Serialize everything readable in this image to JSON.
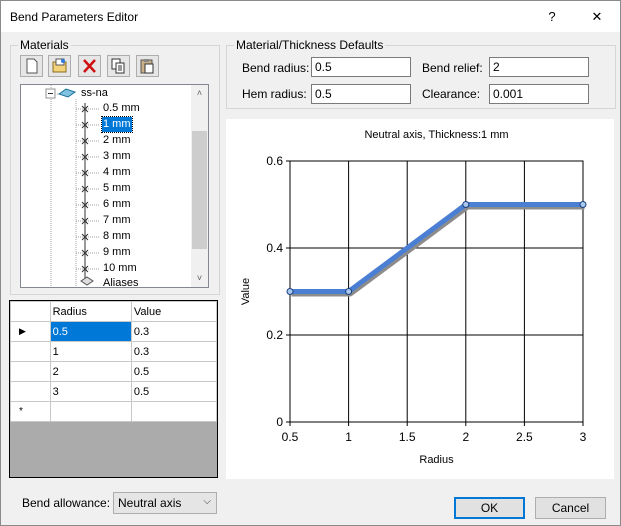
{
  "window": {
    "title": "Bend Parameters Editor",
    "help_label": "?",
    "close_label": "✕"
  },
  "materials": {
    "group_label": "Materials",
    "toolbar": [
      "new-icon",
      "open-icon",
      "delete-icon",
      "copy-icon",
      "paste-icon"
    ],
    "tree": {
      "root_label": "ss-na",
      "items": [
        "0.5 mm",
        "1 mm",
        "2 mm",
        "3 mm",
        "4 mm",
        "5 mm",
        "6 mm",
        "7 mm",
        "8 mm",
        "9 mm",
        "10 mm",
        "Aliases"
      ],
      "selected": "1 mm"
    },
    "grid": {
      "headers": [
        "Radius",
        "Value"
      ],
      "rows": [
        [
          "0.5",
          "0.3"
        ],
        [
          "1",
          "0.3"
        ],
        [
          "2",
          "0.5"
        ],
        [
          "3",
          "0.5"
        ]
      ],
      "new_row_marker": "*",
      "current_row_marker": "▶"
    }
  },
  "defaults": {
    "group_label": "Material/Thickness Defaults",
    "bend_radius_label": "Bend radius:",
    "bend_radius": "0.5",
    "bend_relief_label": "Bend relief:",
    "bend_relief": "2",
    "hem_radius_label": "Hem radius:",
    "hem_radius": "0.5",
    "clearance_label": "Clearance:",
    "clearance": "0.001"
  },
  "bend_allowance": {
    "label": "Bend allowance:",
    "value": "Neutral axis"
  },
  "buttons": {
    "ok": "OK",
    "cancel": "Cancel"
  },
  "chart_data": {
    "type": "line",
    "title": "Neutral axis, Thickness:1 mm",
    "xlabel": "Radius",
    "ylabel": "Value",
    "x": [
      0.5,
      1,
      2,
      3
    ],
    "series": [
      {
        "values": [
          0.3,
          0.3,
          0.5,
          0.5
        ]
      }
    ],
    "xlim": [
      0.5,
      3
    ],
    "ylim": [
      0,
      0.6
    ],
    "xticks": [
      "0.5",
      "1",
      "1.5",
      "2",
      "2.5",
      "3"
    ],
    "yticks": [
      "0",
      "0.2",
      "0.4",
      "0.6"
    ],
    "grid": true,
    "line_color": "#4a7fd4"
  }
}
